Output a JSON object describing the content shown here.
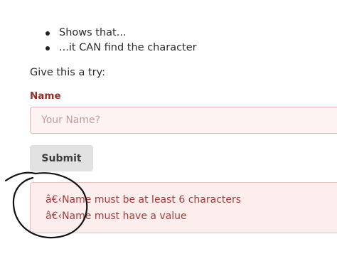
{
  "bullets": [
    "Shows that...",
    "...it CAN find the character"
  ],
  "intro": "Give this a try:",
  "form": {
    "name_label": "Name",
    "name_placeholder": "Your Name?",
    "name_value": "",
    "submit_label": "Submit"
  },
  "errors": [
    "â€‹Name must be at least 6 characters",
    "â€‹Name must have a value"
  ],
  "annotation": {
    "shape": "hand-drawn circle around the garbled characters",
    "color": "#111111"
  },
  "colors": {
    "label": "#9b2c2c",
    "error_text": "#a83a3a",
    "error_bg": "#fdeeee",
    "input_bg": "#fef3f3",
    "button_bg": "#e1e1e1"
  }
}
